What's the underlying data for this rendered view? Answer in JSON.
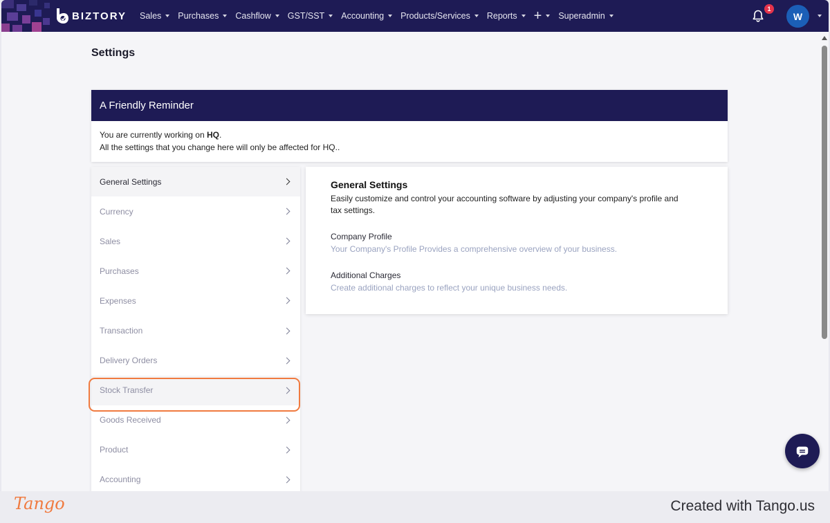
{
  "app": {
    "brand": "BIZTORY"
  },
  "nav": {
    "items": [
      {
        "label": "Sales"
      },
      {
        "label": "Purchases"
      },
      {
        "label": "Cashflow"
      },
      {
        "label": "GST/SST"
      },
      {
        "label": "Accounting"
      },
      {
        "label": "Products/Services"
      },
      {
        "label": "Reports"
      }
    ],
    "plus_label": "+",
    "superadmin": "Superadmin",
    "notification_count": "1",
    "avatar_initial": "W"
  },
  "page": {
    "title": "Settings"
  },
  "reminder": {
    "title": "A Friendly Reminder",
    "line1_prefix": "You are currently working on ",
    "line1_branch": "HQ",
    "line1_suffix": ".",
    "line2": "All the settings that you change here will only be affected for HQ.."
  },
  "sidebar": {
    "items": [
      {
        "label": "General Settings",
        "active": true
      },
      {
        "label": "Currency"
      },
      {
        "label": "Sales"
      },
      {
        "label": "Purchases"
      },
      {
        "label": "Expenses"
      },
      {
        "label": "Transaction"
      },
      {
        "label": "Delivery Orders"
      },
      {
        "label": "Stock Transfer",
        "highlighted": true
      },
      {
        "label": "Goods Received"
      },
      {
        "label": "Product"
      },
      {
        "label": "Accounting"
      }
    ]
  },
  "content": {
    "title": "General Settings",
    "description": "Easily customize and control your accounting software by adjusting your company's profile and tax settings.",
    "links": [
      {
        "title": "Company Profile",
        "desc": "Your Company's Profile Provides a comprehensive overview of your business."
      },
      {
        "title": "Additional Charges",
        "desc": "Create additional charges to reflect your unique business needs."
      }
    ]
  },
  "footer": {
    "logo": "Tango",
    "created": "Created with Tango.us"
  },
  "colors": {
    "nav_bg": "#1e1b55",
    "highlight": "#f07a3f",
    "accent": "#1b5fb7",
    "badge": "#e5334b"
  }
}
